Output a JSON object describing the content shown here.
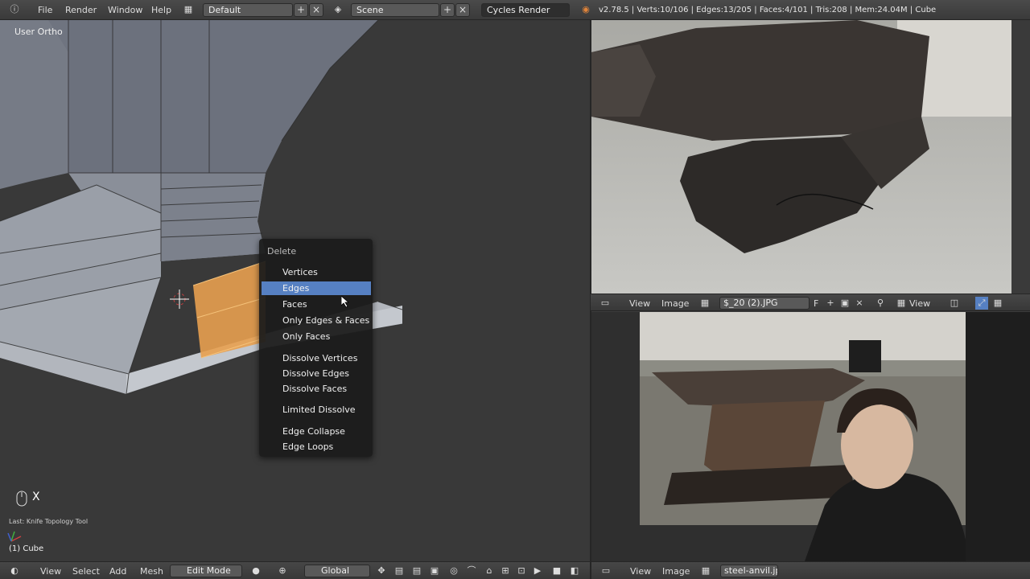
{
  "topbar": {
    "menus": [
      "File",
      "Render",
      "Window",
      "Help"
    ],
    "screen_layout": "Default",
    "scene": "Scene",
    "render_engine": "Cycles Render",
    "stats": "v2.78.5 | Verts:10/106 | Edges:13/205 | Faces:4/101 | Tris:208 | Mem:24.04M | Cube"
  },
  "viewport": {
    "view_label": "User Ortho",
    "key_indicator": "X",
    "last_operator": "Last: Knife Topology Tool",
    "object_name": "(1) Cube"
  },
  "delete_menu": {
    "title": "Delete",
    "items": [
      "Vertices",
      "Edges",
      "Faces",
      "Only Edges & Faces",
      "Only Faces",
      "Dissolve Vertices",
      "Dissolve Edges",
      "Dissolve Faces",
      "Limited Dissolve",
      "Edge Collapse",
      "Edge Loops"
    ],
    "highlighted": "Edges"
  },
  "viewport_header": {
    "menus": [
      "View",
      "Select",
      "Add",
      "Mesh"
    ],
    "mode": "Edit Mode",
    "orientation": "Global"
  },
  "image_editor_top_header": {
    "menus": [
      "View",
      "Image"
    ],
    "image_name": "$_20 (2).JPG",
    "fake_user": "F",
    "view_label": "View"
  },
  "image_editor_bottom_header": {
    "menus": [
      "View",
      "Image"
    ],
    "image_name": "steel-anvil.jpg"
  },
  "colors": {
    "menu_highlight": "#5680c2",
    "selection_face": "#e8a050",
    "background": "#393939"
  }
}
